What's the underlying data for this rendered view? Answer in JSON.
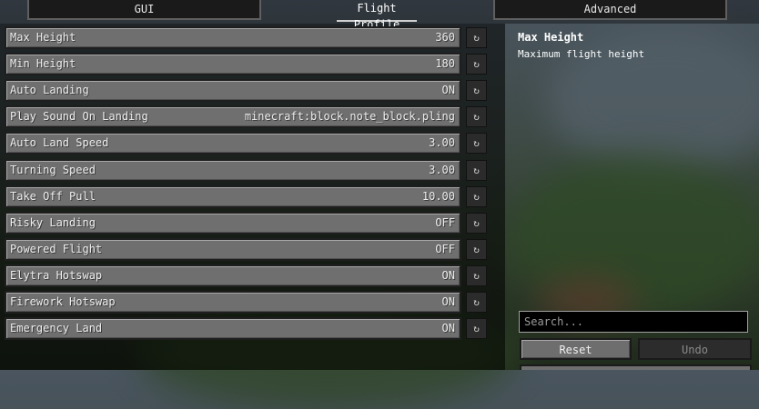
{
  "tabs": {
    "left": "GUI",
    "center": "Flight Profile",
    "right": "Advanced"
  },
  "options": [
    {
      "label": "Max Height",
      "value": "360"
    },
    {
      "label": "Min Height",
      "value": "180"
    },
    {
      "label": "Auto Landing",
      "value": "ON"
    },
    {
      "label": "Play Sound On Landing",
      "value": "minecraft:block.note_block.pling"
    },
    {
      "label": "Auto Land Speed",
      "value": "3.00"
    },
    {
      "label": "Turning Speed",
      "value": "3.00"
    },
    {
      "label": "Take Off Pull",
      "value": "10.00"
    },
    {
      "label": "Risky Landing",
      "value": "OFF"
    },
    {
      "label": "Powered Flight",
      "value": "OFF"
    },
    {
      "label": "Elytra Hotswap",
      "value": "ON"
    },
    {
      "label": "Firework Hotswap",
      "value": "ON"
    },
    {
      "label": "Emergency Land",
      "value": "ON"
    }
  ],
  "reset_glyph": "↻",
  "description": {
    "title": "Max Height",
    "text": "Maximum flight height"
  },
  "search": {
    "placeholder": "Search..."
  },
  "buttons": {
    "reset": "Reset",
    "undo": "Undo"
  }
}
